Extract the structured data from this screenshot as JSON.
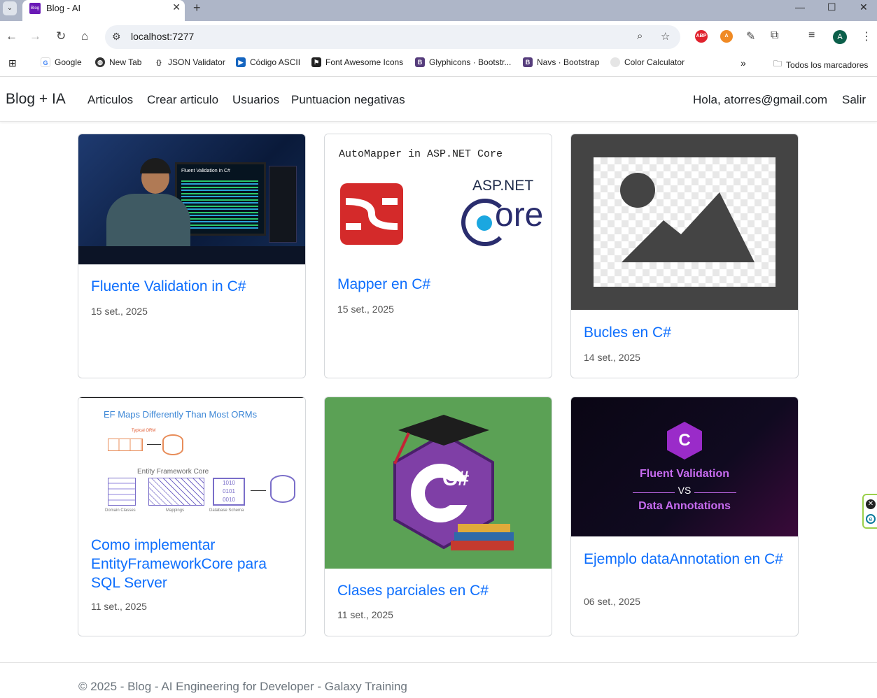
{
  "browser": {
    "tab_title": "Blog - AI",
    "favicon_text": "Blog",
    "url": "localhost:7277",
    "avatar_initial": "A",
    "bookmarks": [
      {
        "label": "Google",
        "icon": "google-icon",
        "color": "#4285f4"
      },
      {
        "label": "New Tab",
        "icon": "globe-icon",
        "color": "#333333"
      },
      {
        "label": "JSON Validator",
        "icon": "braces-icon",
        "color": "#333333"
      },
      {
        "label": "Código ASCII",
        "icon": "play-icon",
        "color": "#1565c0"
      },
      {
        "label": "Font Awesome Icons",
        "icon": "flag-icon",
        "color": "#222222"
      },
      {
        "label": "Glyphicons · Bootstr...",
        "icon": "bootstrap-icon",
        "color": "#563d7c"
      },
      {
        "label": "Navs · Bootstrap",
        "icon": "bootstrap-icon",
        "color": "#563d7c"
      },
      {
        "label": "Color Calculator",
        "icon": "circle-icon",
        "color": "#dddddd"
      }
    ],
    "all_bookmarks": "Todos los marcadores"
  },
  "nav": {
    "brand": "Blog + IA",
    "links": [
      "Articulos",
      "Crear articulo",
      "Usuarios",
      "Puntuacion negativas"
    ],
    "greeting": "Hola, atorres@gmail.com",
    "logout": "Salir"
  },
  "cards": [
    {
      "title": "Fluente Validation in C#",
      "date": "15 set., 2025",
      "image": "developer-illustration",
      "overlay": "Fluent Validation in C#"
    },
    {
      "title": "Mapper en C#",
      "date": "15 set., 2025",
      "image": "automapper-logo",
      "overlay": "AutoMapper in ASP.NET Core",
      "aspnet": "ASP.NET",
      "core": "ore"
    },
    {
      "title": "Bucles en C#",
      "date": "14 set., 2025",
      "image": "placeholder-image"
    },
    {
      "title": "Como implementar EntityFrameworkCore para SQL Server",
      "date": "11 set., 2025",
      "image": "ef-diagram",
      "overlay": "EF Maps Differently Than Most ORMs",
      "ef_typical": "Typical ORM",
      "ef_core": "Entity Framework Core",
      "ef_labels": [
        "Domain Classes",
        "Mappings",
        "Database Schema"
      ]
    },
    {
      "title": "Clases parciales en C#",
      "date": "11 set., 2025",
      "image": "csharp-logo",
      "overlay": "C#"
    },
    {
      "title": "Ejemplo dataAnnotation en C#",
      "date": "06 set., 2025",
      "image": "fluent-vs-annotations",
      "overlay_top": "Fluent Validation",
      "overlay_mid": "VS",
      "overlay_bot": "Data Annotations"
    }
  ],
  "footer": "© 2025 - Blog - AI Engineering for Developer - Galaxy Training"
}
